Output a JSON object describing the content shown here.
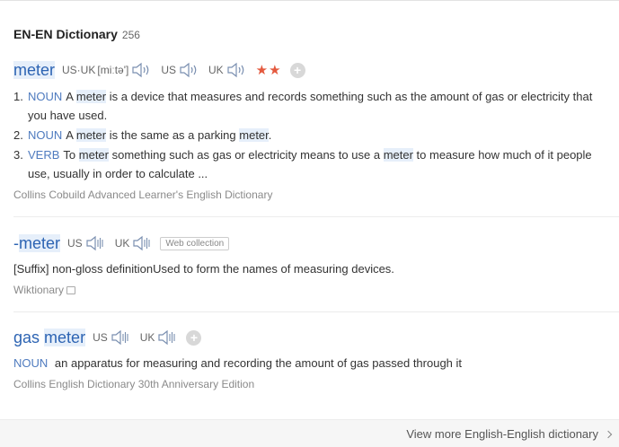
{
  "header": {
    "title": "EN-EN Dictionary",
    "count": "256"
  },
  "entries": [
    {
      "headword": "meter",
      "pron_us_uk": {
        "label": "US·UK",
        "ipa": "[miːtə']"
      },
      "pron_us": {
        "label": "US"
      },
      "pron_uk": {
        "label": "UK"
      },
      "stars": "★★",
      "defs": [
        {
          "num": "1.",
          "pos": "NOUN",
          "parts": [
            "A",
            "meter",
            "is a device that measures and records something such as the amount of gas or electricity that you have used."
          ]
        },
        {
          "num": "2.",
          "pos": "NOUN",
          "parts": [
            "A",
            "meter",
            "is the same as a parking",
            "meter",
            "."
          ]
        },
        {
          "num": "3.",
          "pos": "VERB",
          "parts": [
            "To",
            "meter",
            "something such as gas or electricity means to use a",
            "meter",
            "to measure how much of it people use, usually in order to calculate ..."
          ]
        }
      ],
      "source": "Collins Cobuild Advanced Learner's English Dictionary"
    },
    {
      "headword_prefix": "-",
      "headword": "meter",
      "pron_us": {
        "label": "US"
      },
      "pron_uk": {
        "label": "UK"
      },
      "badge": "Web collection",
      "definition": "[Suffix] non-gloss definitionUsed to form the names of measuring devices.",
      "source": "Wiktionary"
    },
    {
      "headword_first": "gas",
      "headword": "meter",
      "pron_us": {
        "label": "US"
      },
      "pron_uk": {
        "label": "UK"
      },
      "pos": "NOUN",
      "definition": "an apparatus for measuring and recording the amount of gas passed through it",
      "source": "Collins English Dictionary 30th Anniversary Edition"
    }
  ],
  "footer": {
    "view_more": "View more English-English dictionary"
  },
  "colors": {
    "accent": "#2d64b3",
    "pos": "#4f7bbf",
    "highlight": "#e6effa",
    "stars": "#e4593e"
  },
  "icons": [
    "speaker-icon",
    "add-icon",
    "copy-icon",
    "chevron-right-icon"
  ]
}
